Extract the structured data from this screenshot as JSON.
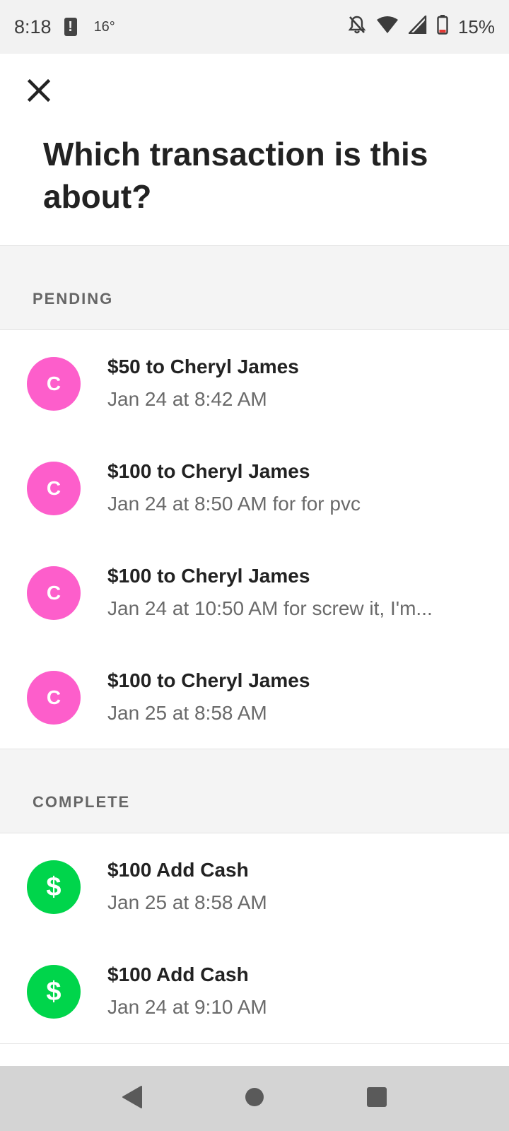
{
  "status_bar": {
    "time": "8:18",
    "alert_glyph": "!",
    "temperature": "16°",
    "battery_percent": "15%",
    "icons": [
      "alert-icon",
      "bell-off-icon",
      "wifi-icon",
      "signal-icon",
      "battery-low-icon"
    ]
  },
  "header": {
    "close_icon": "close-icon",
    "title": "Which transaction is this about?"
  },
  "sections": [
    {
      "label": "PENDING",
      "items": [
        {
          "avatar": "C",
          "avatar_color": "#fd5ecb",
          "title": "$50 to Cheryl James",
          "subtitle": "Jan 24 at 8:42 AM"
        },
        {
          "avatar": "C",
          "avatar_color": "#fd5ecb",
          "title": "$100 to Cheryl James",
          "subtitle": "Jan 24 at 8:50 AM for for pvc"
        },
        {
          "avatar": "C",
          "avatar_color": "#fd5ecb",
          "title": "$100 to Cheryl James",
          "subtitle": "Jan 24 at 10:50 AM for screw it, I'm..."
        },
        {
          "avatar": "C",
          "avatar_color": "#fd5ecb",
          "title": "$100 to Cheryl James",
          "subtitle": "Jan 25 at 8:58 AM"
        }
      ]
    },
    {
      "label": "COMPLETE",
      "items": [
        {
          "avatar": "$",
          "avatar_color": "#00d54b",
          "title": "$100 Add Cash",
          "subtitle": "Jan 25 at 8:58 AM"
        },
        {
          "avatar": "$",
          "avatar_color": "#00d54b",
          "title": "$100 Add Cash",
          "subtitle": "Jan 24 at 9:10 AM"
        }
      ]
    }
  ],
  "nav_bar": {
    "icons": [
      "back-icon",
      "home-icon",
      "recents-icon"
    ]
  }
}
